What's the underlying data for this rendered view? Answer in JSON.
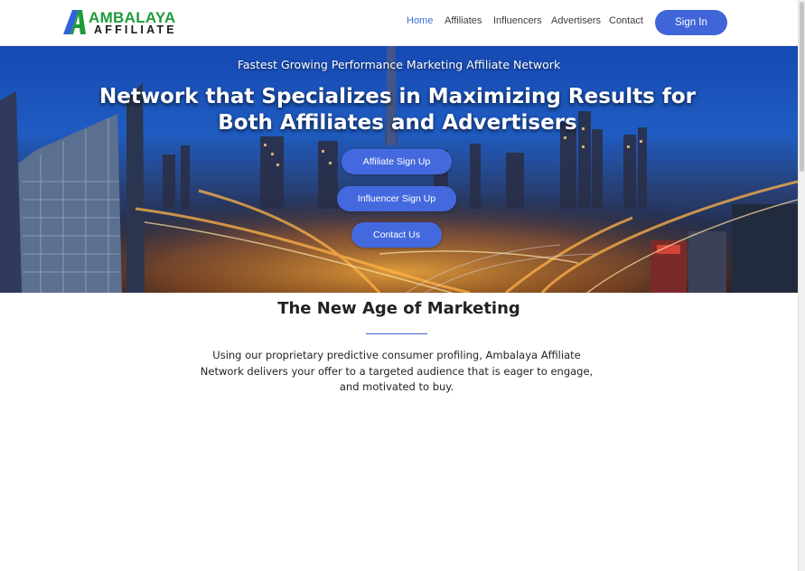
{
  "brand": {
    "name_top": "AMBALAYA",
    "name_bottom": "AFFILIATE",
    "colors": {
      "green": "#1e9b3a",
      "blue": "#2f63d6",
      "dark": "#1a1a1a"
    }
  },
  "nav": {
    "items": [
      {
        "label": "Home",
        "active": true
      },
      {
        "label": "Affiliates",
        "active": false
      },
      {
        "label": "Influencers",
        "active": false
      },
      {
        "label": "Advertisers",
        "active": false
      },
      {
        "label": "Contact",
        "active": false
      }
    ],
    "sign_in_label": "Sign In"
  },
  "hero": {
    "subtitle": "Fastest Growing Performance Marketing Affiliate Network",
    "title": "Network that Specializes in Maximizing Results for Both Affiliates and Advertisers",
    "buttons": [
      {
        "label": "Affiliate Sign Up"
      },
      {
        "label": "Influencer Sign Up"
      },
      {
        "label": "Contact Us"
      }
    ],
    "background": "city-skyline-at-night"
  },
  "intro": {
    "title": "The New Age of Marketing",
    "body": "Using our proprietary predictive consumer profiling, Ambalaya Affiliate Network delivers your offer to a targeted audience that is eager to engage, and motivated to buy."
  },
  "theme": {
    "accent": "#3f65d8",
    "nav_active": "#3b6fd8",
    "text": "#222222"
  }
}
